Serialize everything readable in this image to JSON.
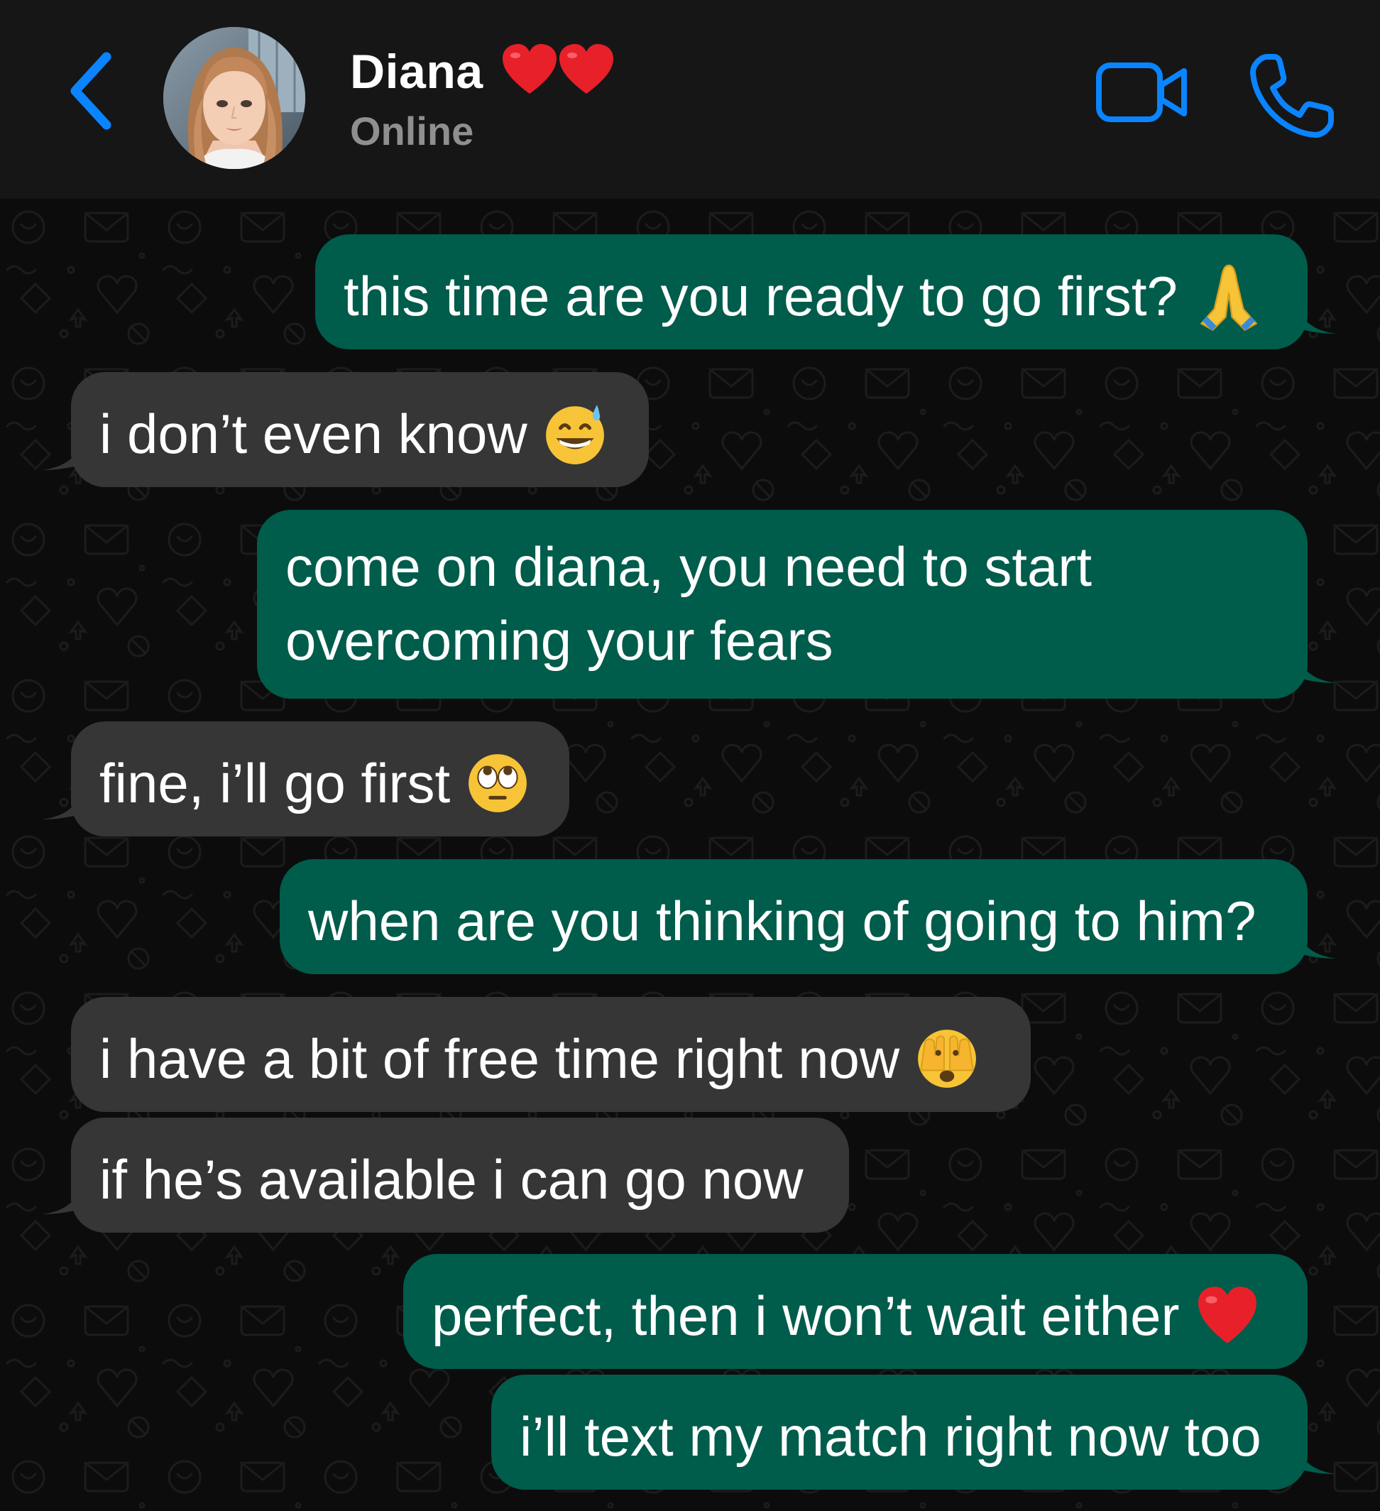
{
  "header": {
    "contact_name": "Diana",
    "contact_status": "Online",
    "icons": {
      "back": "chevron-left-icon",
      "video": "video-camera-icon",
      "call": "phone-icon",
      "name_decoration": "red-heart-emoji"
    }
  },
  "colors": {
    "header_bg": "#161616",
    "accent_blue": "#0a84ff",
    "outgoing_bubble": "#005c4b",
    "incoming_bubble": "#363636",
    "chat_bg": "#0c0c0c"
  },
  "messages": [
    {
      "direction": "out",
      "text": "this time are you ready to go first?",
      "emoji": "folded-hands-emoji"
    },
    {
      "direction": "in",
      "text": "i don’t even know",
      "emoji": "grinning-sweat-emoji"
    },
    {
      "direction": "out",
      "lines": [
        "come on diana, you need to start",
        "overcoming your fears"
      ]
    },
    {
      "direction": "in",
      "text": "fine, i’ll go first",
      "emoji": "eye-roll-emoji"
    },
    {
      "direction": "out",
      "text": "when are you thinking of going to him?"
    },
    {
      "direction": "in",
      "text": "i have a bit of free time right now",
      "emoji": "peeking-face-emoji"
    },
    {
      "direction": "in",
      "text": "if he’s available i can go now"
    },
    {
      "direction": "out",
      "text": "perfect, then i won’t wait either",
      "emoji": "red-heart-emoji"
    },
    {
      "direction": "out",
      "text": "i’ll text my match right now too"
    }
  ]
}
